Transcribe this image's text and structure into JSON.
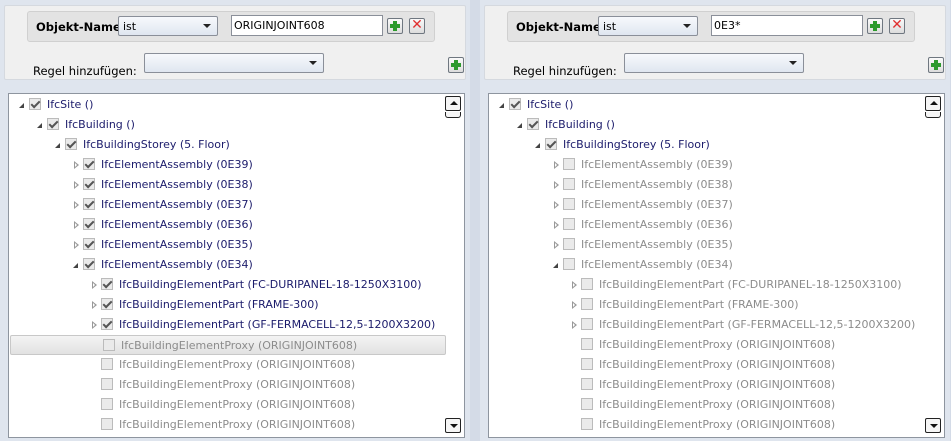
{
  "panels": [
    {
      "filter": {
        "field_label": "Objekt-Name",
        "operator": "ist",
        "value": "ORIGINJOINT608"
      },
      "add_rule_label": "Regel hinzufügen:",
      "add_rule_value": "",
      "tree": [
        {
          "label": "IfcSite ()",
          "level": 0,
          "exp": "down",
          "checked": true,
          "dim": false
        },
        {
          "label": "IfcBuilding ()",
          "level": 1,
          "exp": "down",
          "checked": true,
          "dim": false
        },
        {
          "label": "IfcBuildingStorey (5. Floor)",
          "level": 2,
          "exp": "down",
          "checked": true,
          "dim": false
        },
        {
          "label": "IfcElementAssembly (0E39)",
          "level": 3,
          "exp": "right",
          "checked": true,
          "dim": false
        },
        {
          "label": "IfcElementAssembly (0E38)",
          "level": 3,
          "exp": "right",
          "checked": true,
          "dim": false
        },
        {
          "label": "IfcElementAssembly (0E37)",
          "level": 3,
          "exp": "right",
          "checked": true,
          "dim": false
        },
        {
          "label": "IfcElementAssembly (0E36)",
          "level": 3,
          "exp": "right",
          "checked": true,
          "dim": false
        },
        {
          "label": "IfcElementAssembly (0E35)",
          "level": 3,
          "exp": "right",
          "checked": true,
          "dim": false
        },
        {
          "label": "IfcElementAssembly (0E34)",
          "level": 3,
          "exp": "down",
          "checked": true,
          "dim": false
        },
        {
          "label": "IfcBuildingElementPart (FC-DURIPANEL-18-1250X3100)",
          "level": 4,
          "exp": "right",
          "checked": true,
          "dim": false
        },
        {
          "label": "IfcBuildingElementPart (FRAME-300)",
          "level": 4,
          "exp": "right",
          "checked": true,
          "dim": false
        },
        {
          "label": "IfcBuildingElementPart (GF-FERMACELL-12,5-1200X3200)",
          "level": 4,
          "exp": "right",
          "checked": true,
          "dim": false
        },
        {
          "label": "IfcBuildingElementProxy (ORIGINJOINT608)",
          "level": 4,
          "exp": "none",
          "checked": false,
          "dim": true,
          "selected": true
        },
        {
          "label": "IfcBuildingElementProxy (ORIGINJOINT608)",
          "level": 4,
          "exp": "none",
          "checked": false,
          "dim": true
        },
        {
          "label": "IfcBuildingElementProxy (ORIGINJOINT608)",
          "level": 4,
          "exp": "none",
          "checked": false,
          "dim": true
        },
        {
          "label": "IfcBuildingElementProxy (ORIGINJOINT608)",
          "level": 4,
          "exp": "none",
          "checked": false,
          "dim": true
        },
        {
          "label": "IfcBuildingElementProxy (ORIGINJOINT608)",
          "level": 4,
          "exp": "none",
          "checked": false,
          "dim": true
        }
      ]
    },
    {
      "filter": {
        "field_label": "Objekt-Name",
        "operator": "ist",
        "value": "0E3*"
      },
      "add_rule_label": "Regel hinzufügen:",
      "add_rule_value": "",
      "tree": [
        {
          "label": "IfcSite ()",
          "level": 0,
          "exp": "down",
          "checked": true,
          "dim": false
        },
        {
          "label": "IfcBuilding ()",
          "level": 1,
          "exp": "down",
          "checked": true,
          "dim": false
        },
        {
          "label": "IfcBuildingStorey (5. Floor)",
          "level": 2,
          "exp": "down",
          "checked": true,
          "dim": false
        },
        {
          "label": "IfcElementAssembly (0E39)",
          "level": 3,
          "exp": "right",
          "checked": false,
          "dim": true
        },
        {
          "label": "IfcElementAssembly (0E38)",
          "level": 3,
          "exp": "right",
          "checked": false,
          "dim": true
        },
        {
          "label": "IfcElementAssembly (0E37)",
          "level": 3,
          "exp": "right",
          "checked": false,
          "dim": true
        },
        {
          "label": "IfcElementAssembly (0E36)",
          "level": 3,
          "exp": "right",
          "checked": false,
          "dim": true
        },
        {
          "label": "IfcElementAssembly (0E35)",
          "level": 3,
          "exp": "right",
          "checked": false,
          "dim": true
        },
        {
          "label": "IfcElementAssembly (0E34)",
          "level": 3,
          "exp": "down",
          "checked": false,
          "dim": true
        },
        {
          "label": "IfcBuildingElementPart (FC-DURIPANEL-18-1250X3100)",
          "level": 4,
          "exp": "right",
          "checked": false,
          "dim": true
        },
        {
          "label": "IfcBuildingElementPart (FRAME-300)",
          "level": 4,
          "exp": "right",
          "checked": false,
          "dim": true
        },
        {
          "label": "IfcBuildingElementPart (GF-FERMACELL-12,5-1200X3200)",
          "level": 4,
          "exp": "right",
          "checked": false,
          "dim": true
        },
        {
          "label": "IfcBuildingElementProxy (ORIGINJOINT608)",
          "level": 4,
          "exp": "none",
          "checked": false,
          "dim": true
        },
        {
          "label": "IfcBuildingElementProxy (ORIGINJOINT608)",
          "level": 4,
          "exp": "none",
          "checked": false,
          "dim": true
        },
        {
          "label": "IfcBuildingElementProxy (ORIGINJOINT608)",
          "level": 4,
          "exp": "none",
          "checked": false,
          "dim": true
        },
        {
          "label": "IfcBuildingElementProxy (ORIGINJOINT608)",
          "level": 4,
          "exp": "none",
          "checked": false,
          "dim": true
        },
        {
          "label": "IfcBuildingElementProxy (ORIGINJOINT608)",
          "level": 4,
          "exp": "none",
          "checked": false,
          "dim": true
        }
      ]
    }
  ]
}
